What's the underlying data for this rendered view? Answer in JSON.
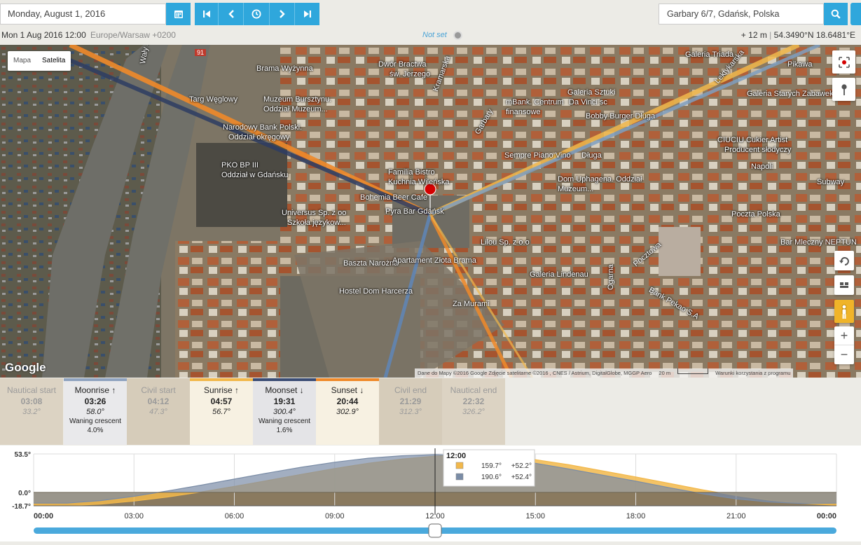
{
  "toolbar": {
    "date": "Monday, August 1, 2016",
    "address": "Garbary 6/7, Gdańsk, Polska",
    "icons": [
      "calendar-icon",
      "skip-back-icon",
      "step-back-icon",
      "clock-icon",
      "step-forward-icon",
      "skip-forward-icon",
      "search-icon"
    ]
  },
  "status": {
    "datetime": "Mon 1 Aug 2016 12:00",
    "timezone": "Europe/Warsaw +0200",
    "not_set": "Not set",
    "elevation": "+ 12 m",
    "separator": "|",
    "coords": "54.3490°N 18.6481°E"
  },
  "map": {
    "type_map": "Mapa",
    "type_satellite": "Satelita",
    "google": "Google",
    "attribution": "Dane do Mapy ©2016 Google Zdjęcie satelitarne ©2016 , CNES / Astrium, DigitalGlobe, MGGP Aero",
    "scale": "20 m",
    "terms": "Warunki korzystania z programu",
    "zoom_in": "+",
    "zoom_out": "−",
    "labels": [
      {
        "text": "Brama Wyżynna"
      },
      {
        "text": "Dwór Bractwa"
      },
      {
        "text": "św. Jerzego"
      },
      {
        "text": "Galeria Triada"
      },
      {
        "text": "Pikawa"
      },
      {
        "text": "Galeria Sztuki"
      },
      {
        "text": "Da Vinci sc"
      },
      {
        "text": "Galeria Starych Zabawek"
      },
      {
        "text": "Targ Węglowy"
      },
      {
        "text": "Muzeum Bursztynu."
      },
      {
        "text": "Oddział Muzeum..."
      },
      {
        "text": "mBank. Centrum"
      },
      {
        "text": "finansowe"
      },
      {
        "text": "Bobby Burger Długa"
      },
      {
        "text": "Narodowy Bank Polski."
      },
      {
        "text": "Oddział okręgowy"
      },
      {
        "text": "CIUCIU Cukier Artist"
      },
      {
        "text": "Producent słodyczy"
      },
      {
        "text": "Sempre Piano Vino"
      },
      {
        "text": "Długa"
      },
      {
        "text": "PKO BP III"
      },
      {
        "text": "Oddział w Gdańsku"
      },
      {
        "text": "Familia Bistro"
      },
      {
        "text": "Kuchnia Wileńska"
      },
      {
        "text": "Napoli"
      },
      {
        "text": "Dom Uphagena. Oddział"
      },
      {
        "text": "Muzeum..."
      },
      {
        "text": "Subway"
      },
      {
        "text": "Bohemia Beer Cafe"
      },
      {
        "text": "Pyra Bar Gdańsk"
      },
      {
        "text": "Poczta Polska"
      },
      {
        "text": "Universus Sp. z oo"
      },
      {
        "text": "Szkoła językow..."
      },
      {
        "text": "Lilou Sp. z o.o"
      },
      {
        "text": "Bar Mleczny NEPTUN"
      },
      {
        "text": "Baszta Narożna"
      },
      {
        "text": "Apartament Złota Brama"
      },
      {
        "text": "Galeria Lindenau"
      },
      {
        "text": "Hostel Dom Harcerza"
      },
      {
        "text": "Bank Pekao S.A"
      },
      {
        "text": "Za Murami"
      },
      {
        "text": "Ogarna"
      },
      {
        "text": "Wały Jagiellońskie"
      },
      {
        "text": "Kramarska"
      },
      {
        "text": "Garbary"
      },
      {
        "text": "Pocztowa"
      },
      {
        "text": "Lektykarska"
      },
      {
        "text": "91"
      }
    ]
  },
  "events": [
    {
      "name": "Nautical start",
      "arrow": "",
      "time": "03:08",
      "azimuth": "33.2°",
      "phase": "",
      "percent": "",
      "bg": "#dcd3c3",
      "fg": "#9a9a9a",
      "bar": ""
    },
    {
      "name": "Moonrise",
      "arrow": "↑",
      "time": "03:26",
      "azimuth": "58.0°",
      "phase": "Waning crescent",
      "percent": "4.0%",
      "bg": "#e9e9eb",
      "fg": "#222222",
      "bar": "#8fa3c0"
    },
    {
      "name": "Civil start",
      "arrow": "",
      "time": "04:12",
      "azimuth": "47.3°",
      "phase": "",
      "percent": "",
      "bg": "#d6ccba",
      "fg": "#9a9a9a",
      "bar": ""
    },
    {
      "name": "Sunrise",
      "arrow": "↑",
      "time": "04:57",
      "azimuth": "56.7°",
      "phase": "",
      "percent": "",
      "bg": "#f7f1e2",
      "fg": "#222222",
      "bar": "#f2b84b"
    },
    {
      "name": "Moonset",
      "arrow": "↓",
      "time": "19:31",
      "azimuth": "300.4°",
      "phase": "Waning crescent",
      "percent": "1.6%",
      "bg": "#e4e4e7",
      "fg": "#222222",
      "bar": "#3b4d75"
    },
    {
      "name": "Sunset",
      "arrow": "↓",
      "time": "20:44",
      "azimuth": "302.9°",
      "phase": "",
      "percent": "",
      "bg": "#f7f1e2",
      "fg": "#222222",
      "bar": "#f08a2a"
    },
    {
      "name": "Civil end",
      "arrow": "",
      "time": "21:29",
      "azimuth": "312.3°",
      "phase": "",
      "percent": "",
      "bg": "#d6ccba",
      "fg": "#9a9a9a",
      "bar": ""
    },
    {
      "name": "Nautical end",
      "arrow": "",
      "time": "22:32",
      "azimuth": "326.2°",
      "phase": "",
      "percent": "",
      "bg": "#dcd3c3",
      "fg": "#9a9a9a",
      "bar": ""
    }
  ],
  "chart_data": {
    "type": "area",
    "ylabels": [
      "53.5°",
      "0.0°",
      "-18.7°"
    ],
    "ylim": [
      -18.7,
      53.5
    ],
    "xlim": [
      0,
      24
    ],
    "xticks": [
      "00:00",
      "03:00",
      "06:00",
      "09:00",
      "12:00",
      "15:00",
      "18:00",
      "21:00",
      "00:00"
    ],
    "xtick_hours": [
      0,
      3,
      6,
      9,
      12,
      15,
      18,
      21,
      24
    ],
    "series": [
      {
        "color": "#f2b84b",
        "hours": [
          0,
          1,
          2,
          3,
          4,
          5,
          6,
          7,
          8,
          9,
          10,
          11,
          12,
          13,
          14,
          15,
          16,
          17,
          18,
          19,
          20,
          21,
          22,
          23,
          24
        ],
        "values": [
          -17.5,
          -18.5,
          -16.5,
          -12.2,
          -6.5,
          0.4,
          8.2,
          16.5,
          25,
          33.2,
          40.5,
          46.3,
          50.5,
          52.2,
          50.3,
          45.5,
          38.5,
          30,
          21.5,
          12.5,
          3.5,
          -4.5,
          -11,
          -15.5,
          -18
        ]
      },
      {
        "color": "#7a8ca6",
        "hours": [
          0,
          1,
          2,
          3,
          4,
          5,
          6,
          7,
          8,
          9,
          10,
          11,
          12,
          13,
          14,
          15,
          16,
          17,
          18,
          19,
          20,
          21,
          22,
          23,
          24
        ],
        "values": [
          -15,
          -15,
          -11.5,
          -5.5,
          2,
          10,
          18.5,
          27,
          35,
          42,
          47.5,
          51,
          52.5,
          51,
          47,
          40.5,
          32.5,
          24,
          15.5,
          6.5,
          -2,
          -9,
          -13.5,
          -15.5,
          -15
        ]
      }
    ],
    "tooltip": {
      "time": "12:00",
      "rows": [
        {
          "color": "#f2b84b",
          "azimuth": "159.7°",
          "altitude": "+52.2°"
        },
        {
          "color": "#7a8ca6",
          "azimuth": "190.6°",
          "altitude": "+52.4°"
        }
      ]
    },
    "current_hour": 12
  }
}
